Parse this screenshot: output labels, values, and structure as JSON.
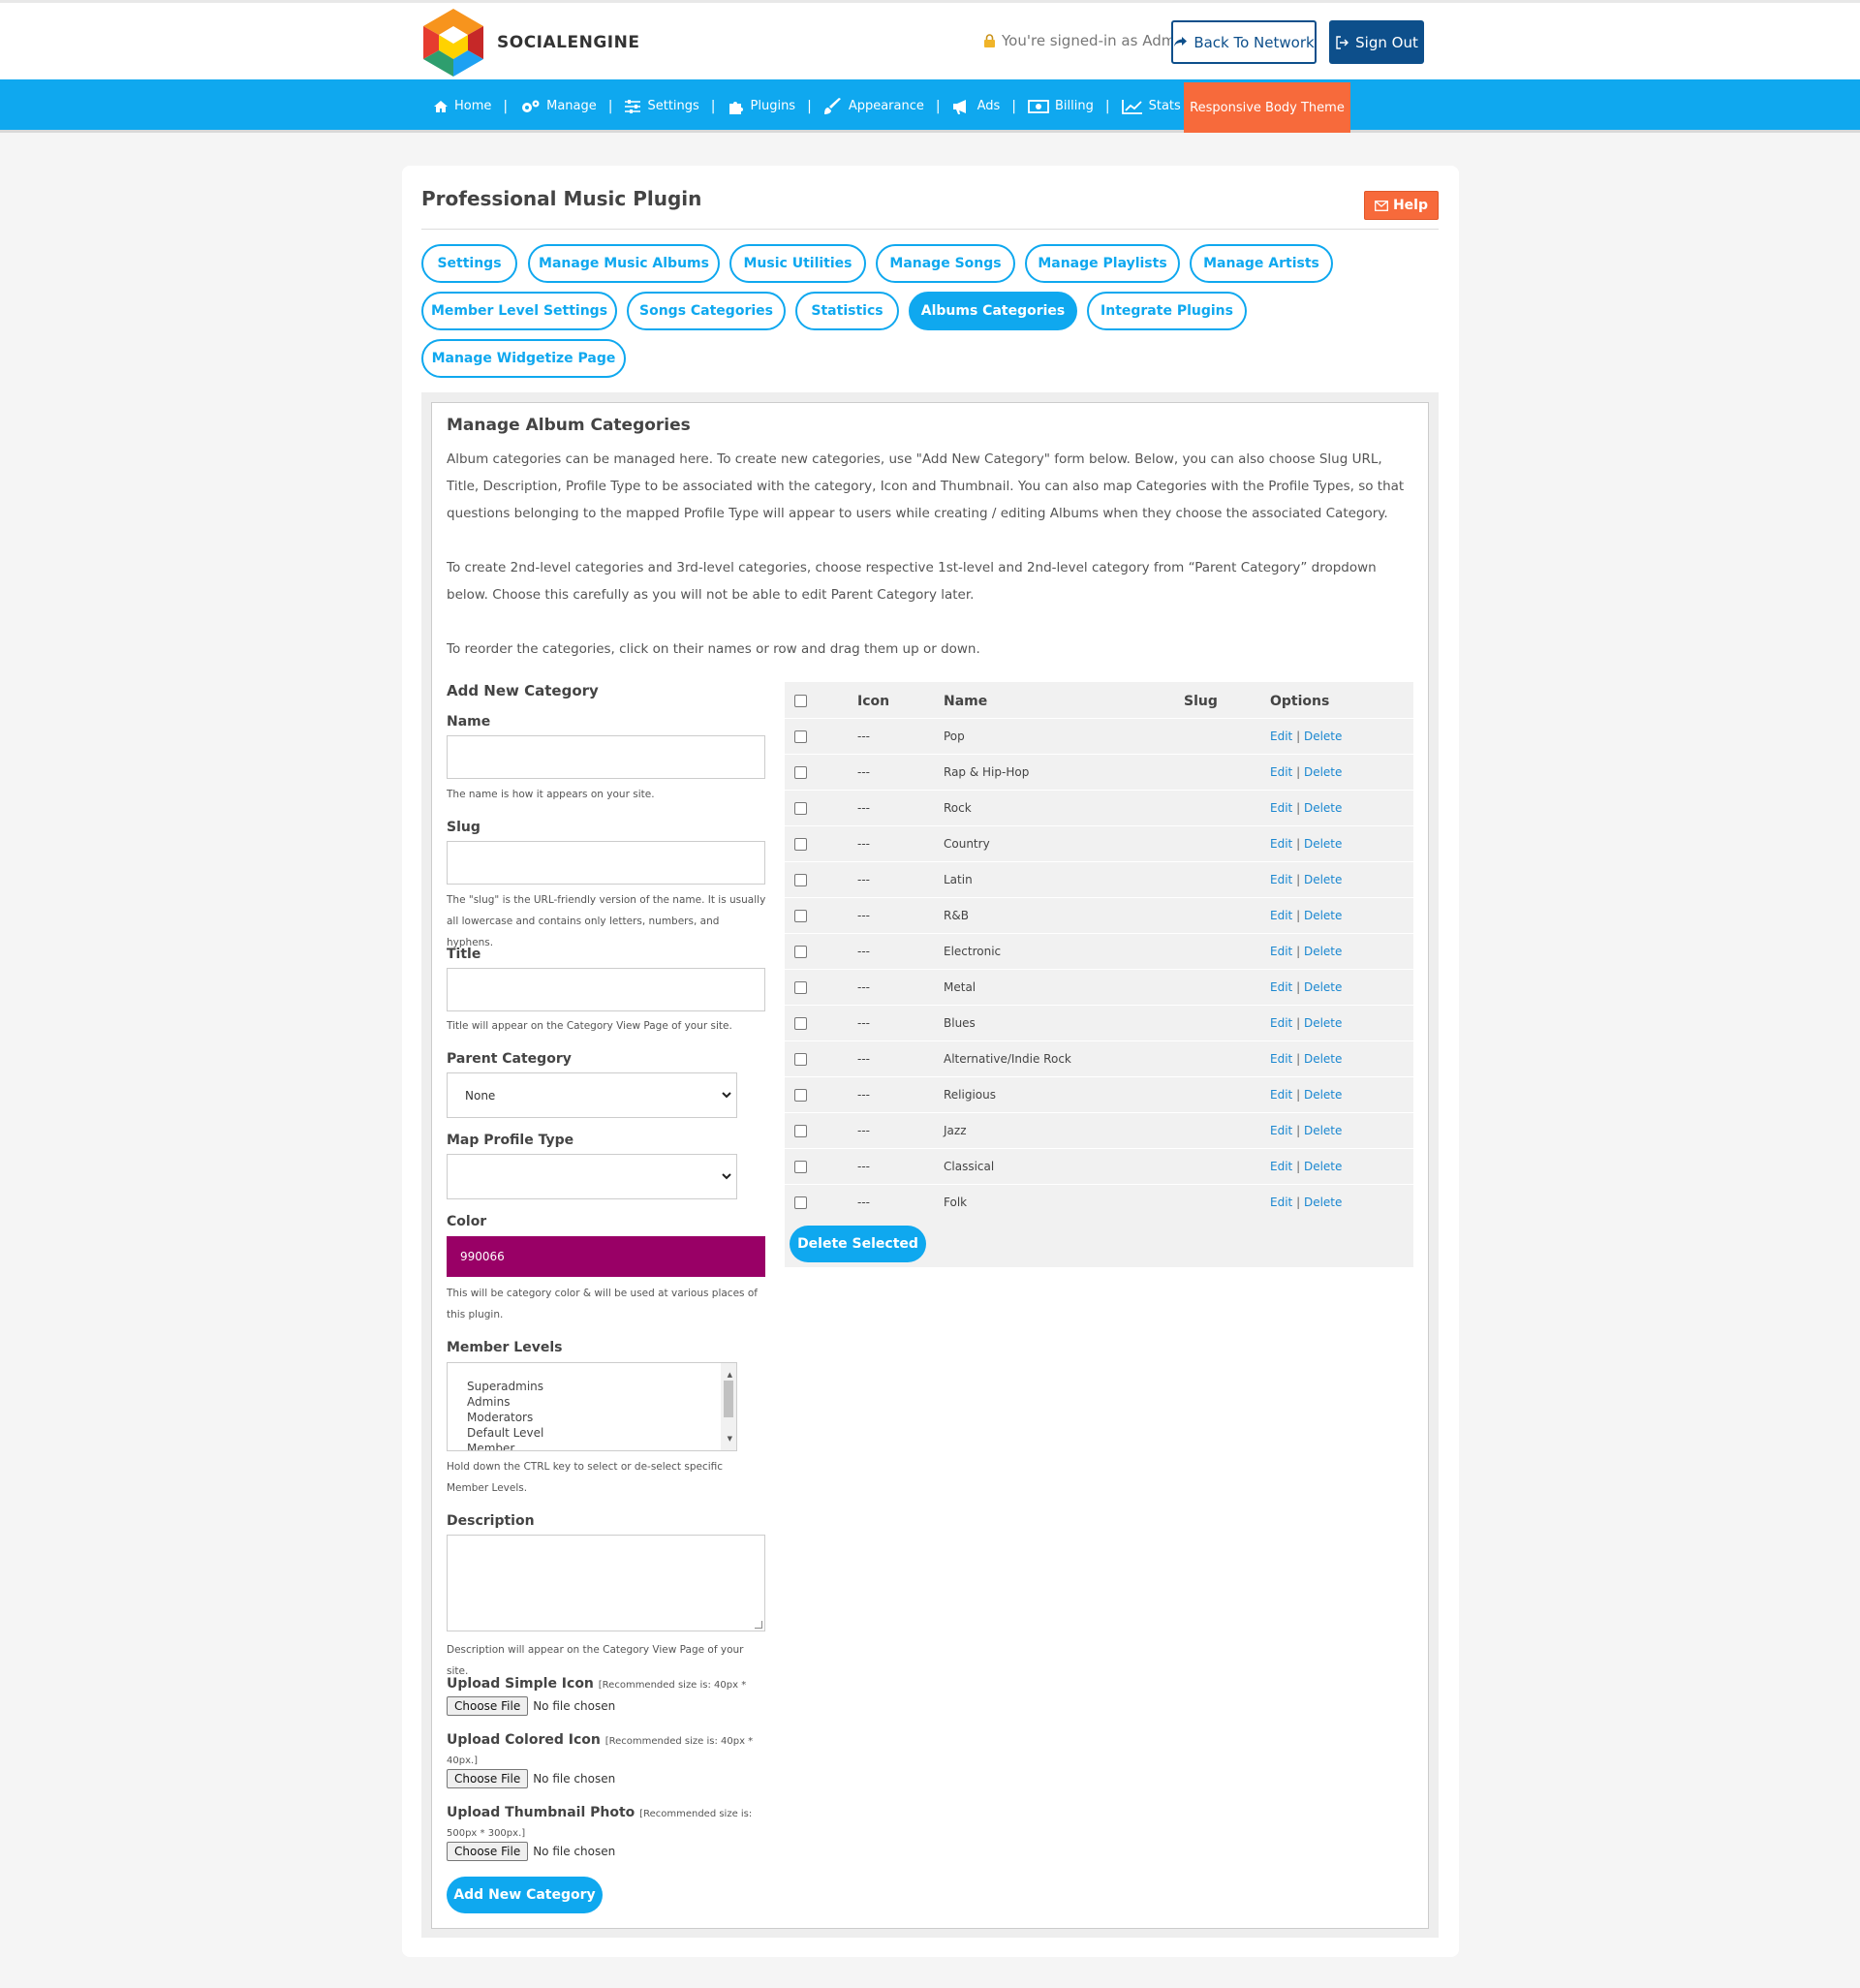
{
  "header": {
    "logo_text": "SOCIALENGINE",
    "signed_in_text": "You're signed-in as Admin",
    "back_label": "Back To Network",
    "signout_label": "Sign Out"
  },
  "nav": {
    "items": [
      {
        "label": "Home",
        "icon": "home-icon"
      },
      {
        "label": "Manage",
        "icon": "gears-icon"
      },
      {
        "label": "Settings",
        "icon": "sliders-icon"
      },
      {
        "label": "Plugins",
        "icon": "puzzle-icon"
      },
      {
        "label": "Appearance",
        "icon": "brush-icon"
      },
      {
        "label": "Ads",
        "icon": "megaphone-icon"
      },
      {
        "label": "Billing",
        "icon": "money-icon"
      },
      {
        "label": "Stats",
        "icon": "chart-icon"
      }
    ],
    "theme_label": "Responsive Body Theme"
  },
  "page": {
    "title": "Professional Music Plugin",
    "help_label": "Help"
  },
  "tabs": [
    {
      "label": "Settings"
    },
    {
      "label": "Manage Music Albums"
    },
    {
      "label": "Music Utilities"
    },
    {
      "label": "Manage Songs"
    },
    {
      "label": "Manage Playlists"
    },
    {
      "label": "Manage Artists"
    },
    {
      "label": "Member Level Settings"
    },
    {
      "label": "Songs Categories"
    },
    {
      "label": "Statistics"
    },
    {
      "label": "Albums Categories",
      "active": true
    },
    {
      "label": "Integrate Plugins"
    },
    {
      "label": "Manage Widgetize Page"
    }
  ],
  "section": {
    "title": "Manage Album Categories",
    "para1": "Album categories can be managed here. To create new categories, use \"Add New Category\" form below. Below, you can also choose Slug URL, Title, Description, Profile Type to be associated with the category, Icon and Thumbnail. You can also map Categories with the Profile Types, so that questions belonging to the mapped Profile Type will appear to users while creating / editing Albums when they choose the associated Category.",
    "para2": "To create 2nd-level categories and 3rd-level categories, choose respective 1st-level and 2nd-level category from “Parent Category” dropdown below. Choose this carefully as you will not be able to edit Parent Category later.",
    "para3": "To reorder the categories, click on their names or row and drag them up or down."
  },
  "form": {
    "title": "Add New Category",
    "name_label": "Name",
    "name_hint": "The name is how it appears on your site.",
    "slug_label": "Slug",
    "slug_hint": "The \"slug\" is the URL-friendly version of the name. It is usually all lowercase and contains only letters, numbers, and hyphens.",
    "title_label": "Title",
    "title_hint": "Title will appear on the Category View Page of your site.",
    "parent_label": "Parent Category",
    "parent_value": "None",
    "profile_label": "Map Profile Type",
    "profile_value": "",
    "color_label": "Color",
    "color_value": "990066",
    "color_hex": "#990066",
    "color_hint": "This will be category color & will be used at various places of this plugin.",
    "levels_label": "Member Levels",
    "levels": [
      "Superadmins",
      "Admins",
      "Moderators",
      "Default Level",
      "Member"
    ],
    "levels_hint": "Hold down the CTRL key to select or de-select specific Member Levels.",
    "desc_label": "Description",
    "desc_hint": "Description will appear on the Category View Page of your site.",
    "simple_icon_label": "Upload Simple Icon",
    "simple_icon_note": "[Recommended size is: 40px * 40px.]",
    "colored_icon_label": "Upload Colored Icon",
    "colored_icon_note": "[Recommended size is: 40px * 40px.]",
    "thumb_label": "Upload Thumbnail Photo",
    "thumb_note": "[Recommended size is: 500px * 300px.]",
    "choose_file": "Choose File",
    "no_file": "No file chosen",
    "submit_label": "Add New Category"
  },
  "table": {
    "headers": {
      "icon": "Icon",
      "name": "Name",
      "slug": "Slug",
      "options": "Options"
    },
    "edit_label": "Edit",
    "sep": "|",
    "delete_label": "Delete",
    "rows": [
      {
        "icon": "---",
        "name": "Pop",
        "slug": ""
      },
      {
        "icon": "---",
        "name": "Rap & Hip-Hop",
        "slug": ""
      },
      {
        "icon": "---",
        "name": "Rock",
        "slug": ""
      },
      {
        "icon": "---",
        "name": "Country",
        "slug": ""
      },
      {
        "icon": "---",
        "name": "Latin",
        "slug": ""
      },
      {
        "icon": "---",
        "name": "R&B",
        "slug": ""
      },
      {
        "icon": "---",
        "name": "Electronic",
        "slug": ""
      },
      {
        "icon": "---",
        "name": "Metal",
        "slug": ""
      },
      {
        "icon": "---",
        "name": "Blues",
        "slug": ""
      },
      {
        "icon": "---",
        "name": "Alternative/Indie Rock",
        "slug": ""
      },
      {
        "icon": "---",
        "name": "Religious",
        "slug": ""
      },
      {
        "icon": "---",
        "name": "Jazz",
        "slug": ""
      },
      {
        "icon": "---",
        "name": "Classical",
        "slug": ""
      },
      {
        "icon": "---",
        "name": "Folk",
        "slug": ""
      }
    ],
    "delete_selected_label": "Delete Selected"
  },
  "colors": {
    "accent": "#0fa8ef",
    "header_dark": "#0d4f8b",
    "orange": "#f76a3b"
  }
}
